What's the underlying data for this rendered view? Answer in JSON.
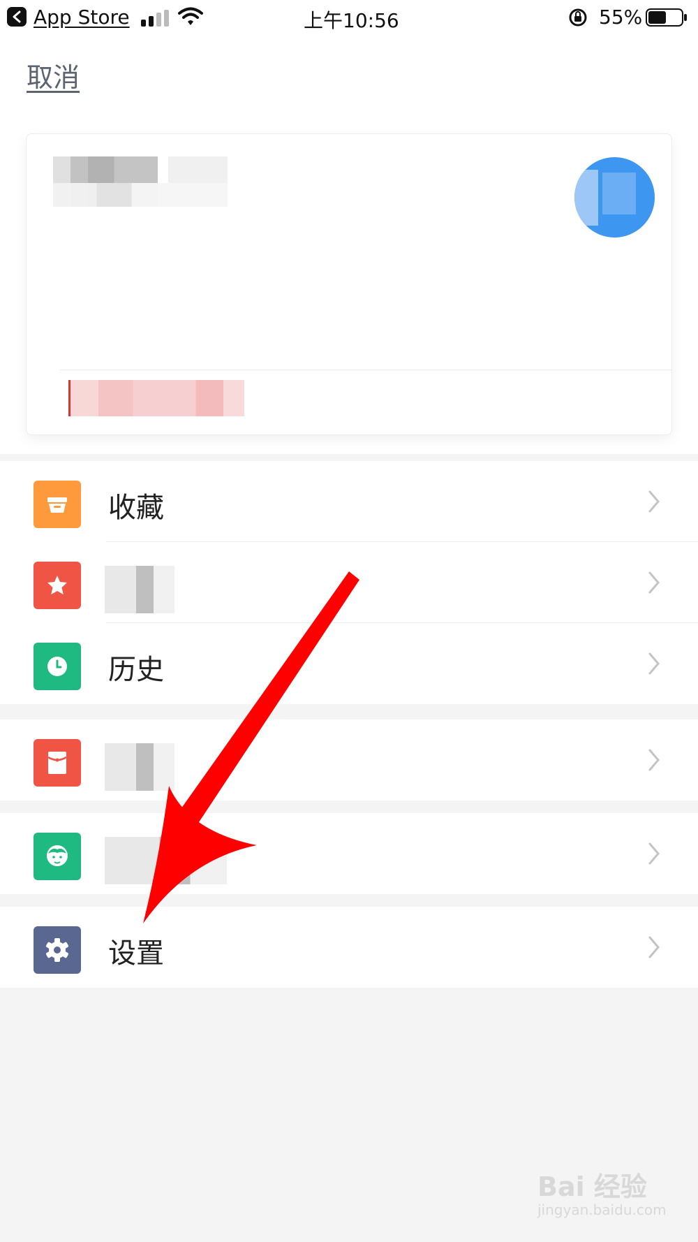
{
  "status_bar": {
    "back_app": "App Store",
    "time": "上午10:56",
    "battery_percent": "55%",
    "battery_level": 0.55,
    "icons": [
      "back-icon",
      "signal-icon",
      "wifi-icon",
      "rotation-lock-icon",
      "battery-icon"
    ]
  },
  "header": {
    "cancel_label": "取消"
  },
  "menu": {
    "group1": [
      {
        "label": "收藏",
        "icon": "favorites-box-icon",
        "color": "#ff9a3c"
      },
      {
        "label": "",
        "icon": "star-icon",
        "color": "#f05445"
      },
      {
        "label": "历史",
        "icon": "clock-icon",
        "color": "#1fba82"
      }
    ],
    "group2": [
      {
        "label": "",
        "icon": "red-envelope-icon",
        "color": "#f05445"
      }
    ],
    "group3": [
      {
        "label": "",
        "icon": "customer-service-icon",
        "color": "#1fba82"
      }
    ],
    "group4": [
      {
        "label": "设置",
        "icon": "gear-icon",
        "color": "#5a6791"
      }
    ]
  },
  "watermark": {
    "brand": "Bai 经验",
    "domain": "jingyan.baidu.com"
  },
  "colors": {
    "background": "#f4f4f4",
    "card": "#ffffff",
    "arrow": "#ff0000",
    "avatar": "#3d96f0"
  }
}
